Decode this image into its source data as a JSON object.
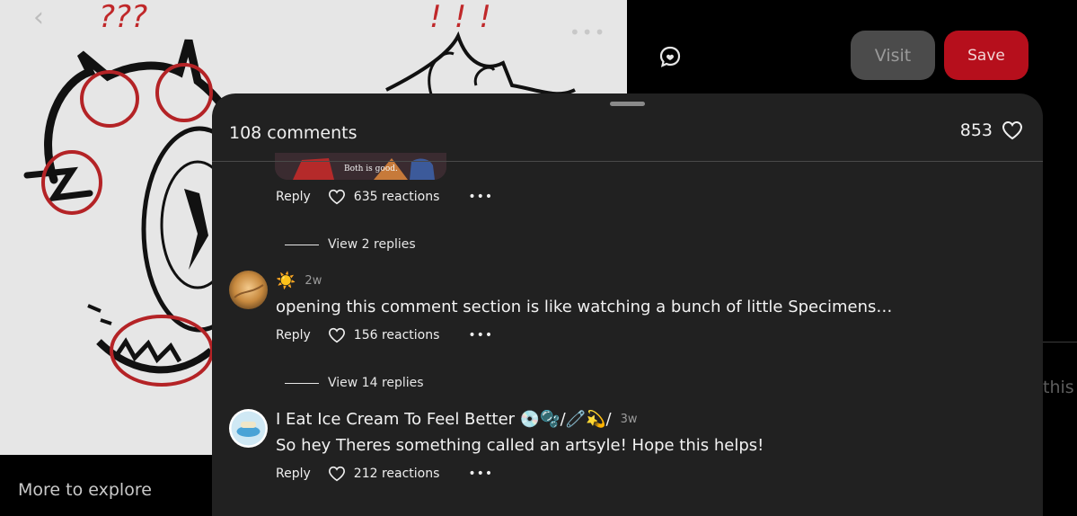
{
  "pin": {
    "annotations_left": "???",
    "annotations_right": "!!!"
  },
  "nav": {
    "back_glyph": "‹",
    "more_glyph": "•••"
  },
  "actions": {
    "visit_label": "Visit",
    "save_label": "Save"
  },
  "explore": {
    "label": "More to explore"
  },
  "right_panel": {
    "partial_text": "this h"
  },
  "comments": {
    "header": {
      "count_label": "108 comments",
      "likes": "853"
    },
    "first_thread": {
      "image_caption": "Both is good.",
      "reply_label": "Reply",
      "reactions": "635 reactions",
      "more": "•••",
      "view_replies": "View 2 replies"
    },
    "items": [
      {
        "author": "☀️",
        "time": "2w",
        "text": "opening this comment section is like watching a bunch of little Specimens…",
        "reply_label": "Reply",
        "reactions": "156 reactions",
        "more": "•••",
        "view_replies": "View 14 replies"
      },
      {
        "author": "I Eat Ice Cream To Feel Better 💿🫧/🧷💫/",
        "time": "3w",
        "text": "So hey Theres something called an artsyle! Hope this helps!",
        "reply_label": "Reply",
        "reactions": "212 reactions",
        "more": "•••"
      }
    ]
  },
  "colors": {
    "save": "#b60f1c",
    "visit": "#4b4b4b",
    "sheet": "#212121"
  }
}
